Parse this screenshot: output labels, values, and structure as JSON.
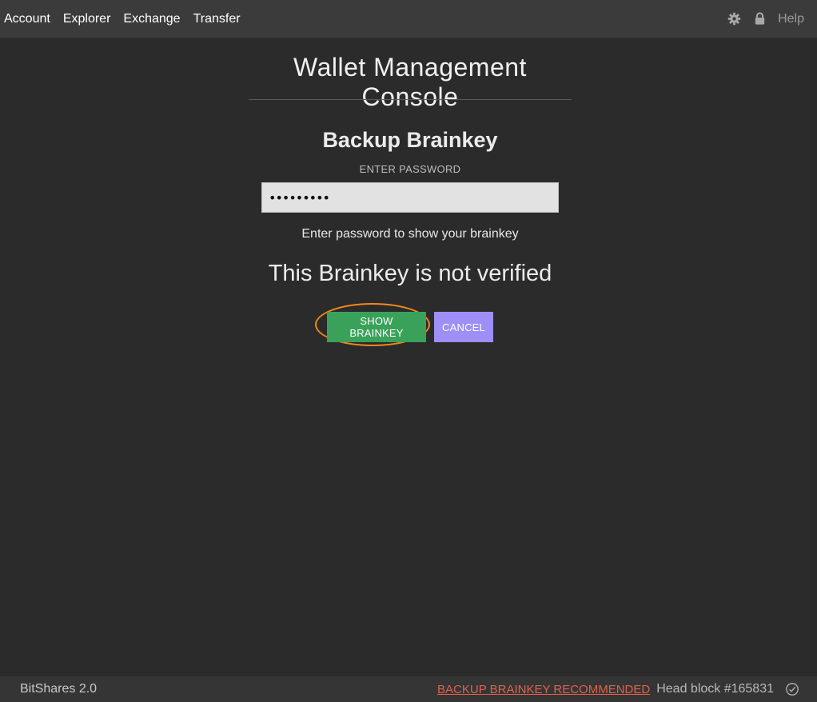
{
  "nav": {
    "items": [
      {
        "label": "Account"
      },
      {
        "label": "Explorer"
      },
      {
        "label": "Exchange"
      },
      {
        "label": "Transfer"
      }
    ],
    "settings_icon": "gear-icon",
    "lock_icon": "lock-icon",
    "help_label": "Help"
  },
  "main": {
    "console_title": "Wallet Management Console",
    "section_title": "Backup Brainkey",
    "password_label": "ENTER PASSWORD",
    "password_value": "•••••••••",
    "hint": "Enter password to show your brainkey",
    "status": "This Brainkey is not verified",
    "show_button_label": "SHOW BRAINKEY",
    "cancel_button_label": "CANCEL"
  },
  "footer": {
    "brand": "BitShares 2.0",
    "backup_link": "BACKUP BRAINKEY RECOMMENDED",
    "head_block": "Head block #165831",
    "sync_icon": "check-circle-icon"
  },
  "colors": {
    "accent_green": "#3aa15a",
    "accent_purple": "#9d8ff5",
    "highlight_orange": "#f0891c",
    "warning_red": "#e2604a"
  }
}
